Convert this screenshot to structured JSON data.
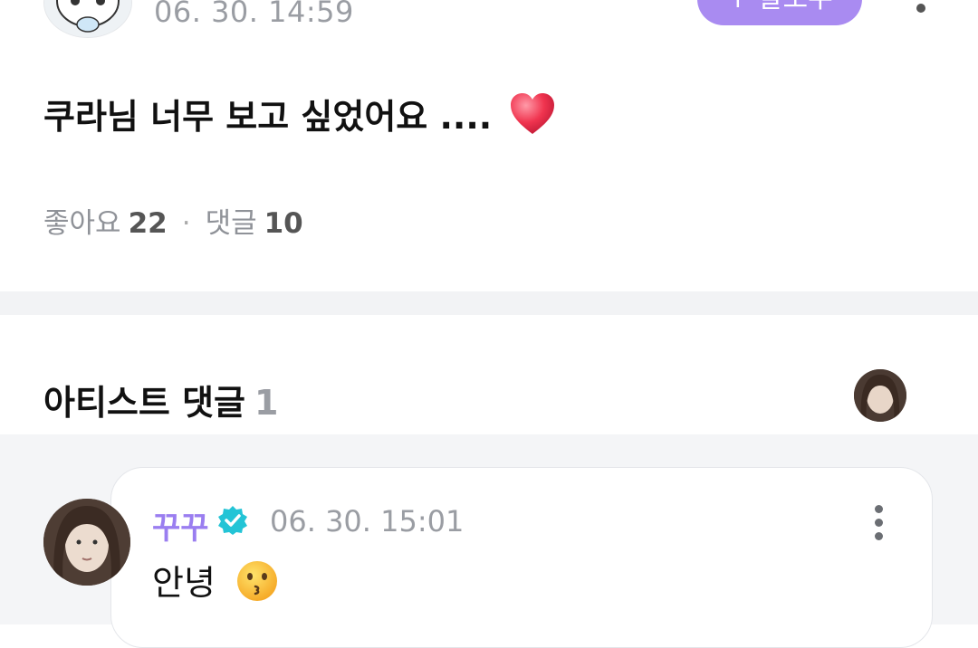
{
  "post": {
    "timestamp": "06. 30. 14:59",
    "follow_label": "+ 팔로우",
    "text": "쿠라님 너무 보고 싶었어요 ....",
    "like_label": "좋아요",
    "like_count": "22",
    "comment_label": "댓글",
    "comment_count": "10"
  },
  "artist_comments": {
    "title": "아티스트 댓글",
    "count": "1"
  },
  "comment": {
    "author": "꾸꾸",
    "timestamp": "06. 30. 15:01",
    "text": "안녕"
  },
  "colors": {
    "accent": "#a98bf1",
    "author": "#9a7ef0",
    "verified": "#23c4d6",
    "muted": "#9a9da3",
    "separator": "#f2f3f5"
  },
  "icons": [
    "avatar",
    "more-vertical-icon",
    "heart-emoji-icon",
    "verified-badge-icon",
    "kiss-emoji-icon"
  ]
}
